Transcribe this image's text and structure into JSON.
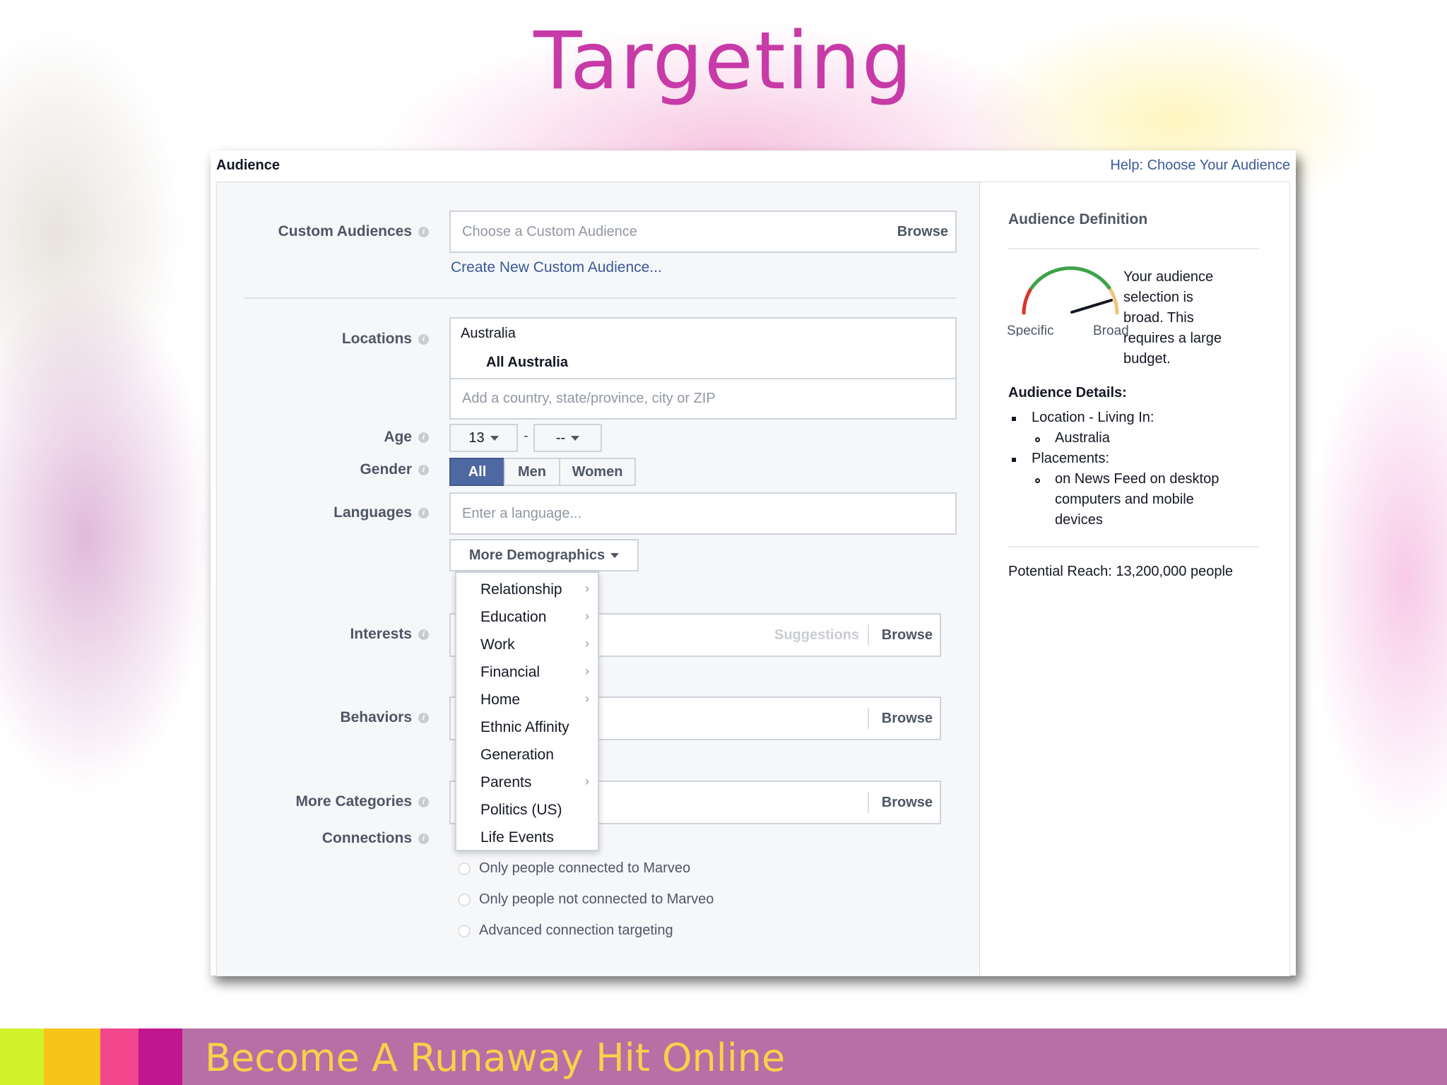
{
  "slide": {
    "title": "Targeting",
    "footer_text": "Become A Runaway Hit Online",
    "footer_swatches": [
      "#d2f22a",
      "#f7c51a",
      "#f2478c",
      "#c0168f"
    ]
  },
  "panel": {
    "title": "Audience",
    "help_link": "Help: Choose Your Audience"
  },
  "custom_audiences": {
    "label": "Custom Audiences",
    "placeholder": "Choose a Custom Audience",
    "browse": "Browse",
    "create_link": "Create New Custom Audience..."
  },
  "locations": {
    "label": "Locations",
    "country": "Australia",
    "selected": "All Australia",
    "placeholder": "Add a country, state/province, city or ZIP"
  },
  "age": {
    "label": "Age",
    "min": "13",
    "max": "--"
  },
  "gender": {
    "label": "Gender",
    "options": [
      "All",
      "Men",
      "Women"
    ],
    "selected": "All"
  },
  "languages": {
    "label": "Languages",
    "placeholder": "Enter a language..."
  },
  "more_demographics": {
    "label": "More Demographics",
    "items": [
      {
        "label": "Relationship",
        "submenu": true
      },
      {
        "label": "Education",
        "submenu": true
      },
      {
        "label": "Work",
        "submenu": true
      },
      {
        "label": "Financial",
        "submenu": true
      },
      {
        "label": "Home",
        "submenu": true
      },
      {
        "label": "Ethnic Affinity",
        "submenu": false
      },
      {
        "label": "Generation",
        "submenu": false
      },
      {
        "label": "Parents",
        "submenu": true
      },
      {
        "label": "Politics (US)",
        "submenu": false
      },
      {
        "label": "Life Events",
        "submenu": false
      }
    ]
  },
  "interests": {
    "label": "Interests",
    "suggestions": "Suggestions",
    "browse": "Browse"
  },
  "behaviors": {
    "label": "Behaviors",
    "browse": "Browse"
  },
  "more_categories": {
    "label": "More Categories",
    "browse": "Browse"
  },
  "connections": {
    "label": "Connections",
    "options": [
      "Only people connected to Marveo",
      "Only people not connected to Marveo",
      "Advanced connection targeting"
    ]
  },
  "audience_definition": {
    "title": "Audience Definition",
    "gauge_specific": "Specific",
    "gauge_broad": "Broad",
    "gauge_level": "broad",
    "summary": [
      "Your audience",
      "selection is",
      "broad. This",
      "requires a large",
      "budget."
    ],
    "details_title": "Audience Details:",
    "location_heading": "Location - Living In:",
    "location_value": "Australia",
    "placements_heading": "Placements:",
    "placements_value": [
      "on News Feed on desktop",
      "computers and mobile",
      "devices"
    ],
    "potential_reach": "Potential Reach: 13,200,000 people"
  },
  "colors": {
    "title_magenta": "#c73aa7",
    "facebook_blue": "#3b5998",
    "footer_purple": "#b76fa5",
    "footer_text_yellow": "#f6d24a"
  }
}
